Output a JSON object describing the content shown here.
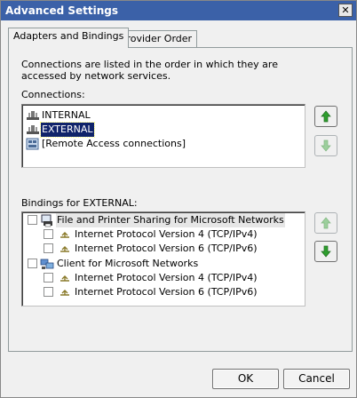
{
  "window": {
    "title": "Advanced Settings",
    "close_glyph": "✕"
  },
  "tabs": [
    {
      "label": "Adapters and Bindings",
      "active": true
    },
    {
      "label": "Provider Order",
      "active": false
    }
  ],
  "description": "Connections are listed in the order in which they are accessed by network services.",
  "connections": {
    "label": "Connections:",
    "items": [
      {
        "label": "INTERNAL",
        "icon": "network-adapter-icon",
        "selected": false
      },
      {
        "label": "EXTERNAL",
        "icon": "network-adapter-icon",
        "selected": true
      },
      {
        "label": "[Remote Access connections]",
        "icon": "remote-access-icon",
        "selected": false
      }
    ],
    "move_up_enabled": true,
    "move_down_enabled": false
  },
  "bindings": {
    "label": "Bindings for EXTERNAL:",
    "items": [
      {
        "label": "File and Printer Sharing for Microsoft Networks",
        "level": 0,
        "checked": false,
        "icon": "file-printer-sharing-icon",
        "highlighted": true
      },
      {
        "label": "Internet Protocol Version 4 (TCP/IPv4)",
        "level": 1,
        "checked": false,
        "icon": "protocol-icon",
        "highlighted": false
      },
      {
        "label": "Internet Protocol Version 6 (TCP/IPv6)",
        "level": 1,
        "checked": false,
        "icon": "protocol-icon",
        "highlighted": false
      },
      {
        "label": "Client for Microsoft Networks",
        "level": 0,
        "checked": false,
        "icon": "network-client-icon",
        "highlighted": false
      },
      {
        "label": "Internet Protocol Version 4 (TCP/IPv4)",
        "level": 1,
        "checked": false,
        "icon": "protocol-icon",
        "highlighted": false
      },
      {
        "label": "Internet Protocol Version 6 (TCP/IPv6)",
        "level": 1,
        "checked": false,
        "icon": "protocol-icon",
        "highlighted": false
      }
    ],
    "move_up_enabled": false,
    "move_down_enabled": true
  },
  "buttons": {
    "ok": "OK",
    "cancel": "Cancel"
  },
  "colors": {
    "titlebar": "#3b61a8",
    "selection": "#10246a",
    "arrow_enabled": "#2e9e2e",
    "arrow_disabled": "#9ccf9c"
  }
}
